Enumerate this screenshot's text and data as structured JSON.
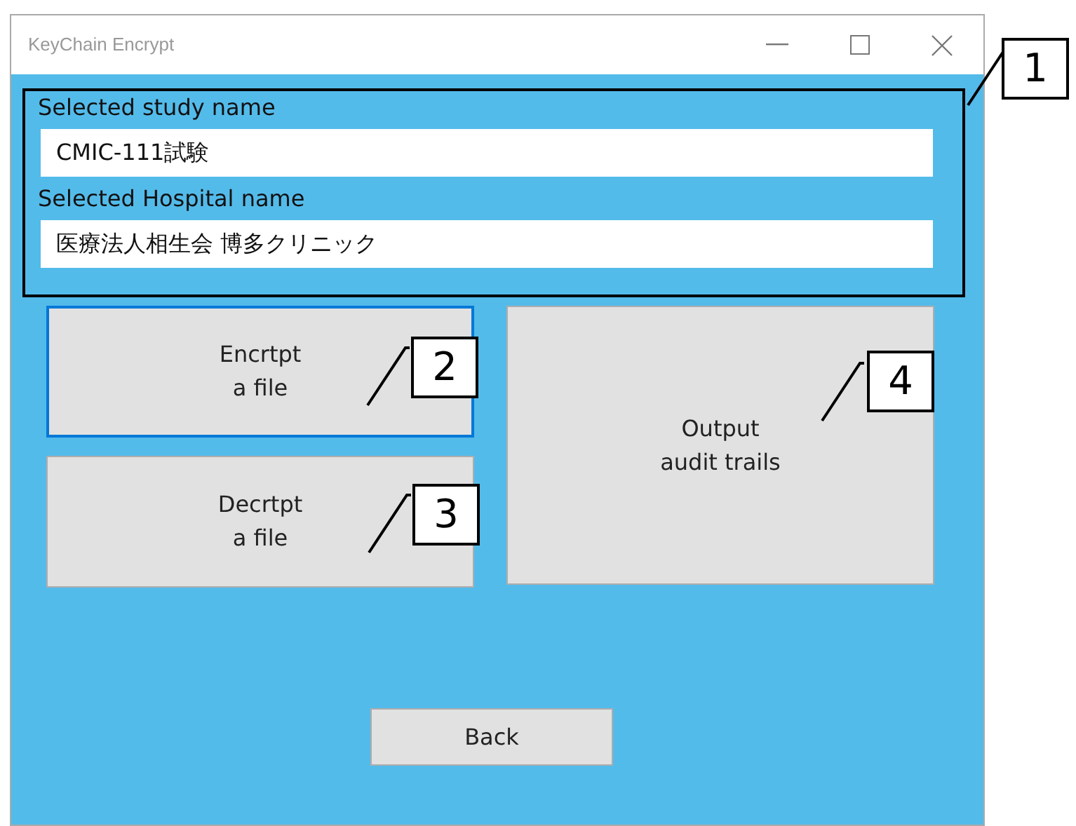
{
  "window": {
    "title": "KeyChain Encrypt"
  },
  "fields": [
    {
      "label": "Selected study name",
      "value": "CMIC-111試験"
    },
    {
      "label": "Selected Hospital name",
      "value": "医療法人相生会 博多クリニック"
    }
  ],
  "buttons": [
    {
      "label": "Encrtpt\na file",
      "focused": true
    },
    {
      "label": "Decrtpt\na file",
      "focused": false
    },
    {
      "label": "Output\naudit trails",
      "focused": false
    }
  ],
  "back_button": {
    "label": "Back"
  },
  "callouts": [
    "1",
    "2",
    "3",
    "4"
  ]
}
